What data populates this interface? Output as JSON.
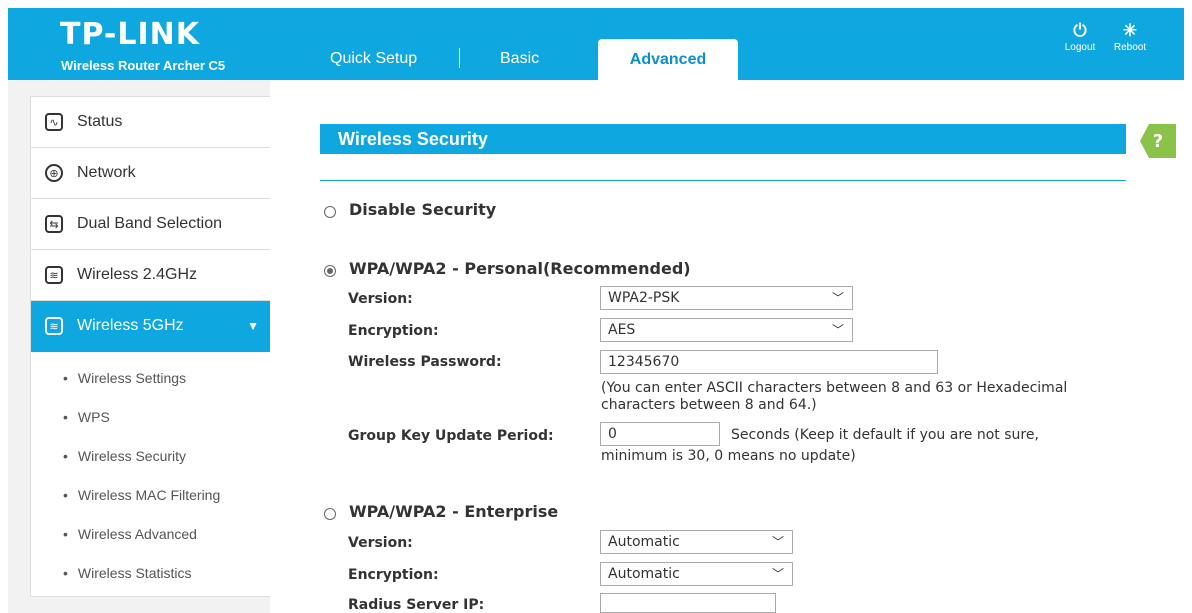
{
  "header": {
    "logo": "TP-LINK",
    "model": "Wireless Router Archer C5",
    "nav": [
      "Quick Setup",
      "Basic",
      "Advanced"
    ],
    "logout_label": "Logout",
    "reboot_label": "Reboot",
    "accent": "#0fa7e0"
  },
  "sidebar": {
    "items": [
      {
        "label": "Status",
        "icon": "status-icon"
      },
      {
        "label": "Network",
        "icon": "globe-icon"
      },
      {
        "label": "Dual Band Selection",
        "icon": "dual-band-icon"
      },
      {
        "label": "Wireless 2.4GHz",
        "icon": "wireless-icon"
      },
      {
        "label": "Wireless 5GHz",
        "icon": "wireless-icon"
      }
    ],
    "submenu": [
      "Wireless Settings",
      "WPS",
      "Wireless Security",
      "Wireless MAC Filtering",
      "Wireless Advanced",
      "Wireless Statistics"
    ]
  },
  "main": {
    "title": "Wireless Security",
    "help": "?",
    "disable": {
      "label": "Disable Security",
      "selected": false
    },
    "personal": {
      "label": "WPA/WPA2 - Personal(Recommended)",
      "selected": true,
      "version_label": "Version:",
      "version_value": "WPA2-PSK",
      "encryption_label": "Encryption:",
      "encryption_value": "AES",
      "password_label": "Wireless Password:",
      "password_value": "12345670",
      "password_note_1": "(You can enter ASCII characters between 8 and 63 or Hexadecimal",
      "password_note_2": "characters between 8 and 64.)",
      "gkup_label": "Group Key Update Period:",
      "gkup_value": "0",
      "gkup_note_1": "Seconds (Keep it default if you are not sure,",
      "gkup_note_2": "minimum is 30, 0 means no update)"
    },
    "enterprise": {
      "label": "WPA/WPA2 - Enterprise",
      "selected": false,
      "version_label": "Version:",
      "version_value": "Automatic",
      "encryption_label": "Encryption:",
      "encryption_value": "Automatic",
      "radius_label": "Radius Server IP:",
      "radius_value": ""
    }
  }
}
